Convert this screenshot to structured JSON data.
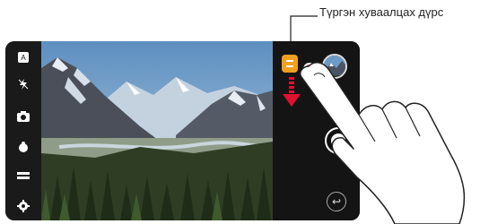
{
  "callout": {
    "label": "Түргэн хуваалцах дүрс"
  },
  "left_bar": {
    "items": [
      {
        "name": "mode-icon"
      },
      {
        "name": "flash-icon"
      },
      {
        "name": "camera-switch-icon"
      },
      {
        "name": "filter-icon"
      },
      {
        "name": "ratio-icon"
      },
      {
        "name": "settings-icon"
      }
    ]
  },
  "right_bar": {
    "shutter": "shutter",
    "back_glyph": "↩"
  },
  "colors": {
    "share_icon": "#f0a020",
    "finger_tip": "#d63a55",
    "arrow": "#e01030"
  }
}
